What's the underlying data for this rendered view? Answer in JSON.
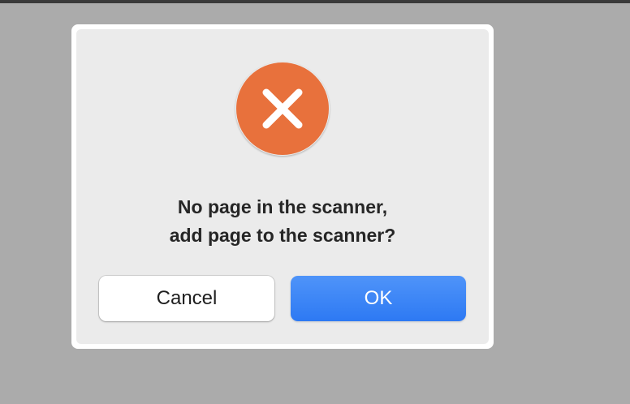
{
  "dialog": {
    "icon": "error-x-circle-icon",
    "icon_color": "#e8713c",
    "message_line1": "No page in the scanner,",
    "message_line2": "add page to the scanner?",
    "cancel_label": "Cancel",
    "ok_label": "OK",
    "ok_color": "#3a83f6"
  }
}
